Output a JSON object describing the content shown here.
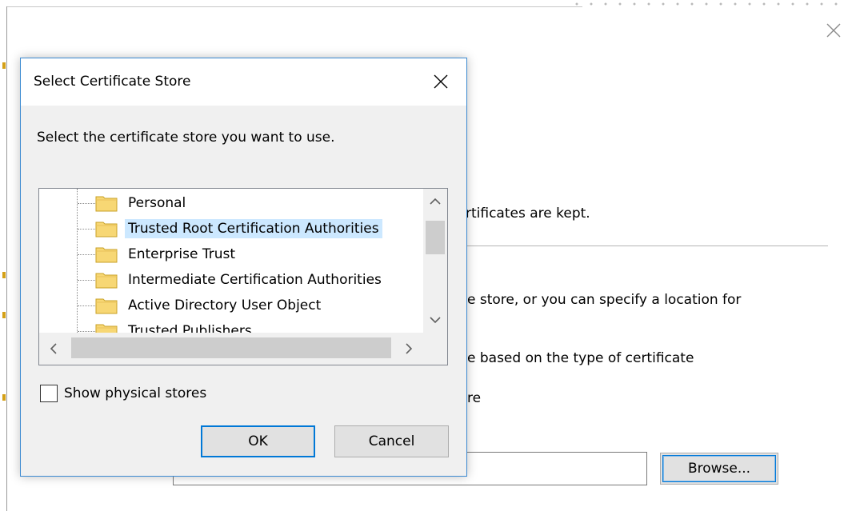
{
  "background_window": {
    "text_line_1": "rtificates are kept.",
    "text_line_2": "e store, or you can specify a location for",
    "text_line_3": "e based on the type of certificate",
    "text_line_4": "re",
    "browse_label": "Browse...",
    "close_icon": "close-icon"
  },
  "dialog": {
    "title": "Select Certificate Store",
    "prompt": "Select the certificate store you want to use.",
    "stores": [
      {
        "label": "Personal",
        "selected": false
      },
      {
        "label": "Trusted Root Certification Authorities",
        "selected": true
      },
      {
        "label": "Enterprise Trust",
        "selected": false
      },
      {
        "label": "Intermediate Certification Authorities",
        "selected": false
      },
      {
        "label": "Active Directory User Object",
        "selected": false
      },
      {
        "label": "Trusted Publishers",
        "selected": false
      }
    ],
    "show_physical_label": "Show physical stores",
    "show_physical_checked": false,
    "ok_label": "OK",
    "cancel_label": "Cancel"
  },
  "colors": {
    "selection": "#cce8ff",
    "accent": "#0078d7",
    "folder": "#f7d774"
  }
}
